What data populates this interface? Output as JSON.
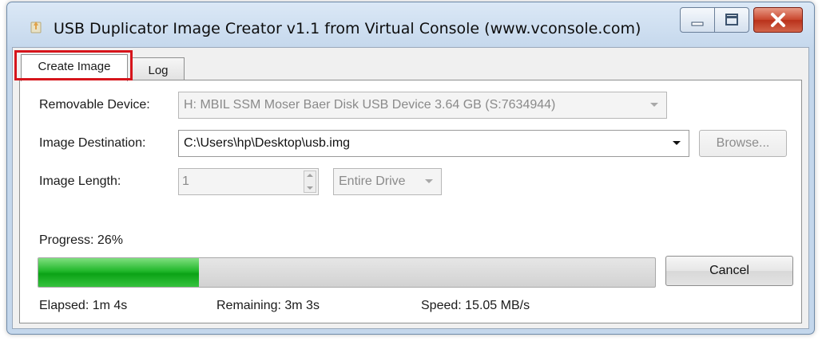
{
  "window": {
    "title": "USB Duplicator Image Creator v1.1 from Virtual Console (www.vconsole.com)",
    "controls": [
      "minimize-icon",
      "maximize-icon",
      "close-icon"
    ]
  },
  "tabs": [
    {
      "label": "Create Image",
      "selected": true
    },
    {
      "label": "Log",
      "selected": false
    }
  ],
  "form": {
    "removable_device": {
      "label": "Removable Device:",
      "value": "H: MBIL SSM Moser Baer Disk USB Device 3.64 GB (S:7634944)"
    },
    "image_destination": {
      "label": "Image Destination:",
      "value": "C:\\Users\\hp\\Desktop\\usb.img",
      "browse_label": "Browse..."
    },
    "image_length": {
      "label": "Image Length:",
      "value": "1",
      "unit": "Entire Drive"
    }
  },
  "progress": {
    "label": "Progress: 26%",
    "fraction": 0.26,
    "cancel_label": "Cancel",
    "elapsed": "Elapsed: 1m 4s",
    "remaining": "Remaining: 3m 3s",
    "speed": "Speed: 15.05 MB/s"
  },
  "colors": {
    "highlight": "#d6151c",
    "progress_fill": "#16ab21"
  }
}
